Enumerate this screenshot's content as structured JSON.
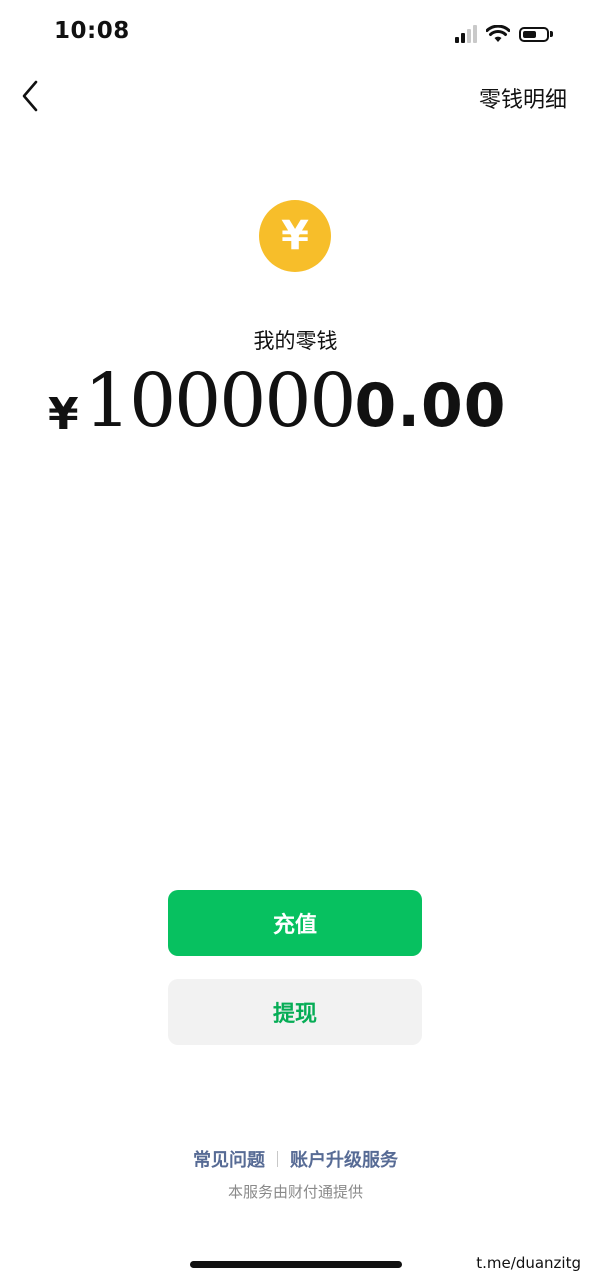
{
  "status_bar": {
    "time": "10:08",
    "icons": [
      "signal-icon",
      "wifi-icon",
      "battery-icon"
    ]
  },
  "nav": {
    "back_icon": "chevron-left-icon",
    "detail_link": "零钱明细"
  },
  "wallet": {
    "icon": "yuan-coin-icon",
    "icon_glyph": "¥",
    "label": "我的零钱",
    "currency": "¥",
    "balance_handwritten": "100000",
    "balance_printed": "0.00"
  },
  "actions": {
    "recharge_label": "充值",
    "withdraw_label": "提现"
  },
  "footer": {
    "faq_link": "常见问题",
    "upgrade_link": "账户升级服务",
    "note": "本服务由财付通提供"
  },
  "watermark": "t.me/duanzitg",
  "colors": {
    "primary_green": "#07c160",
    "coin_yellow": "#f7be2a",
    "link_blue": "#576b95"
  }
}
